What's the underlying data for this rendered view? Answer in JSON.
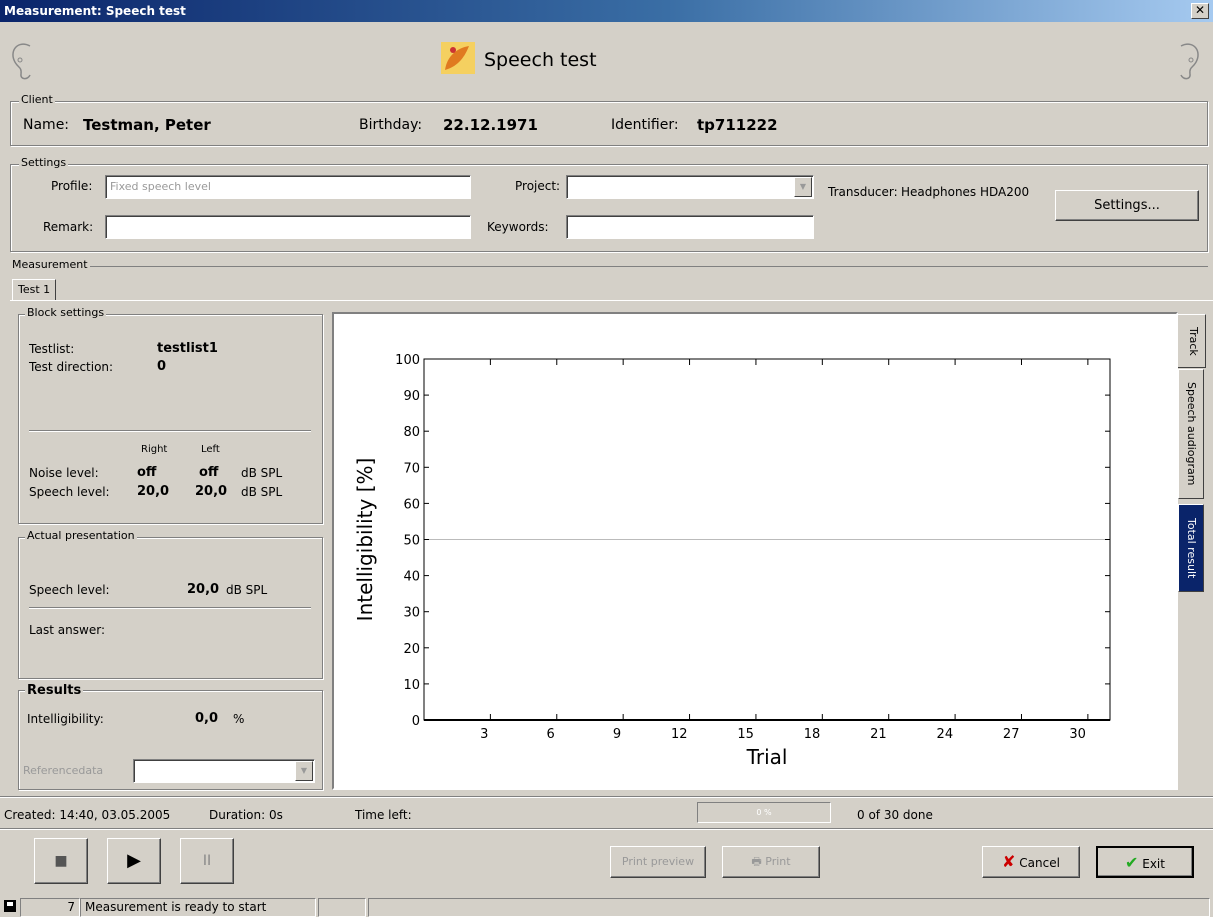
{
  "window": {
    "title": "Measurement: Speech test",
    "close_glyph": "✕"
  },
  "header": {
    "title": "Speech test",
    "left_icon": "ear-left-icon",
    "right_icon": "ear-right-icon",
    "logo_icon": "app-logo-icon"
  },
  "client": {
    "legend": "Client",
    "name_label": "Name:",
    "name_value": "Testman, Peter",
    "birthday_label": "Birthday:",
    "birthday_value": "22.12.1971",
    "identifier_label": "Identifier:",
    "identifier_value": "tp711222"
  },
  "settings": {
    "legend": "Settings",
    "profile_label": "Profile:",
    "profile_value": "Fixed speech level",
    "remark_label": "Remark:",
    "remark_value": "",
    "project_label": "Project:",
    "project_value": "",
    "keywords_label": "Keywords:",
    "keywords_value": "",
    "transducer_label": "Transducer:",
    "transducer_value": "Headphones HDA200",
    "settings_button": "Settings..."
  },
  "measurement": {
    "legend": "Measurement",
    "tab": "Test 1"
  },
  "block_settings": {
    "legend": "Block settings",
    "testlist_label": "Testlist:",
    "testlist_value": "testlist1",
    "direction_label": "Test direction:",
    "direction_value": "0",
    "right_header": "Right",
    "left_header": "Left",
    "noise_label": "Noise level:",
    "noise_right": "off",
    "noise_left": "off",
    "noise_unit": "dB SPL",
    "speech_label": "Speech level:",
    "speech_right": "20,0",
    "speech_left": "20,0",
    "speech_unit": "dB SPL"
  },
  "actual_presentation": {
    "legend": "Actual presentation",
    "speech_label": "Speech level:",
    "speech_value": "20,0",
    "speech_unit": "dB SPL",
    "answer_label": "Last answer:"
  },
  "results": {
    "legend": "Results",
    "intel_label": "Intelligibility:",
    "intel_value": "0,0",
    "intel_unit": "%",
    "ref_label": "Referencedata"
  },
  "side_tabs": [
    "Track",
    "Speech audiogram",
    "Total result"
  ],
  "chart_data": {
    "type": "line",
    "xlabel": "Trial",
    "ylabel": "Intelligibility [%]",
    "xlim": [
      0,
      31
    ],
    "ylim": [
      0,
      100
    ],
    "x_ticks": [
      3,
      6,
      9,
      12,
      15,
      18,
      21,
      24,
      27,
      30
    ],
    "y_ticks": [
      0,
      10,
      20,
      30,
      40,
      50,
      60,
      70,
      80,
      90,
      100
    ],
    "reference_line": 50,
    "series": []
  },
  "footer": {
    "created": "Created: 14:40, 03.05.2005",
    "duration": "Duration: 0s",
    "time_left": "Time left:",
    "progress_text": "0 %",
    "progress_value": 0,
    "done_text": "0 of 30 done"
  },
  "controls": {
    "stop_glyph": "■",
    "play_glyph": "▶",
    "pause_glyph": "II",
    "print_preview": "Print preview",
    "print": "Print",
    "cancel": "Cancel",
    "exit": "Exit"
  },
  "statusbar": {
    "number": "7",
    "message": "Measurement is ready to start"
  }
}
